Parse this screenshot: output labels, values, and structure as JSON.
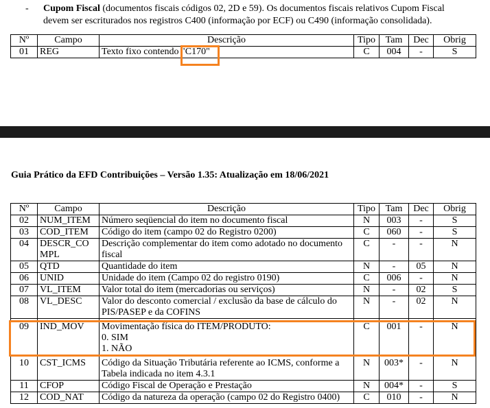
{
  "intro": {
    "bullet": "-",
    "title": "Cupom Fiscal",
    "line1_rest": " (documentos fiscais códigos 02, 2D e 59). Os documentos fiscais relativos Cupom Fiscal",
    "line2": "devem ser escriturados nos registros C400 (informação por ECF) ou C490 (informação consolidada)."
  },
  "headers": {
    "n": "Nº",
    "campo": "Campo",
    "descricao": "Descrição",
    "tipo": "Tipo",
    "tam": "Tam",
    "dec": "Dec",
    "obrig": "Obrig"
  },
  "table1": [
    {
      "n": "01",
      "campo": "REG",
      "desc": "Texto fixo contendo \"C170\"",
      "tipo": "C",
      "tam": "004",
      "dec": "-",
      "obrig": "S"
    }
  ],
  "guide_title": "Guia Prático da EFD Contribuições – Versão 1.35: Atualização em 18/06/2021",
  "table2": [
    {
      "n": "02",
      "campo": "NUM_ITEM",
      "desc": "Número seqüencial do item no documento fiscal",
      "tipo": "N",
      "tam": "003",
      "dec": "-",
      "obrig": "S"
    },
    {
      "n": "03",
      "campo": "COD_ITEM",
      "desc": "Código do item (campo 02 do Registro 0200)",
      "tipo": "C",
      "tam": "060",
      "dec": "-",
      "obrig": "S"
    },
    {
      "n": "04",
      "campo_l1": "DESCR_CO",
      "campo_l2": "MPL",
      "desc_l1": "Descrição complementar do item como adotado no documento",
      "desc_l2": "fiscal",
      "tipo": "C",
      "tam": "-",
      "dec": "-",
      "obrig": "N"
    },
    {
      "n": "05",
      "campo": "QTD",
      "desc": "Quantidade do item",
      "tipo": "N",
      "tam": "-",
      "dec": "05",
      "obrig": "N"
    },
    {
      "n": "06",
      "campo": "UNID",
      "desc": "Unidade do item (Campo 02 do registro 0190)",
      "tipo": "C",
      "tam": "006",
      "dec": "-",
      "obrig": "N"
    },
    {
      "n": "07",
      "campo": "VL_ITEM",
      "desc": "Valor total do item (mercadorias ou serviços)",
      "tipo": "N",
      "tam": "-",
      "dec": "02",
      "obrig": "S"
    },
    {
      "n": "08",
      "campo": "VL_DESC",
      "desc_l1": "Valor do desconto comercial / exclusão da base de cálculo do",
      "desc_l2": "PIS/PASEP e da COFINS",
      "tipo": "N",
      "tam": "-",
      "dec": "02",
      "obrig": "N"
    },
    {
      "n": "09",
      "campo": "IND_MOV",
      "desc_l1": "Movimentação física do ITEM/PRODUTO:",
      "desc_l2": "0. SIM",
      "desc_l3": "1. NÃO",
      "tipo": "C",
      "tam": "001",
      "dec": "-",
      "obrig": "N"
    },
    {
      "n": "10",
      "campo": "CST_ICMS",
      "desc_l1": "Código da Situação Tributária referente ao ICMS, conforme a",
      "desc_l2": "Tabela indicada no item 4.3.1",
      "tipo": "N",
      "tam": "003*",
      "dec": "-",
      "obrig": "N"
    },
    {
      "n": "11",
      "campo": "CFOP",
      "desc": "Código Fiscal de Operação e Prestação",
      "tipo": "N",
      "tam": "004*",
      "dec": "-",
      "obrig": "S"
    },
    {
      "n": "12",
      "campo": "COD_NAT",
      "desc": "Código da natureza da operação (campo 02 do Registro 0400)",
      "tipo": "C",
      "tam": "010",
      "dec": "-",
      "obrig": "N"
    }
  ],
  "colors": {
    "highlight": "#f58220",
    "band": "#1c1c1c"
  }
}
